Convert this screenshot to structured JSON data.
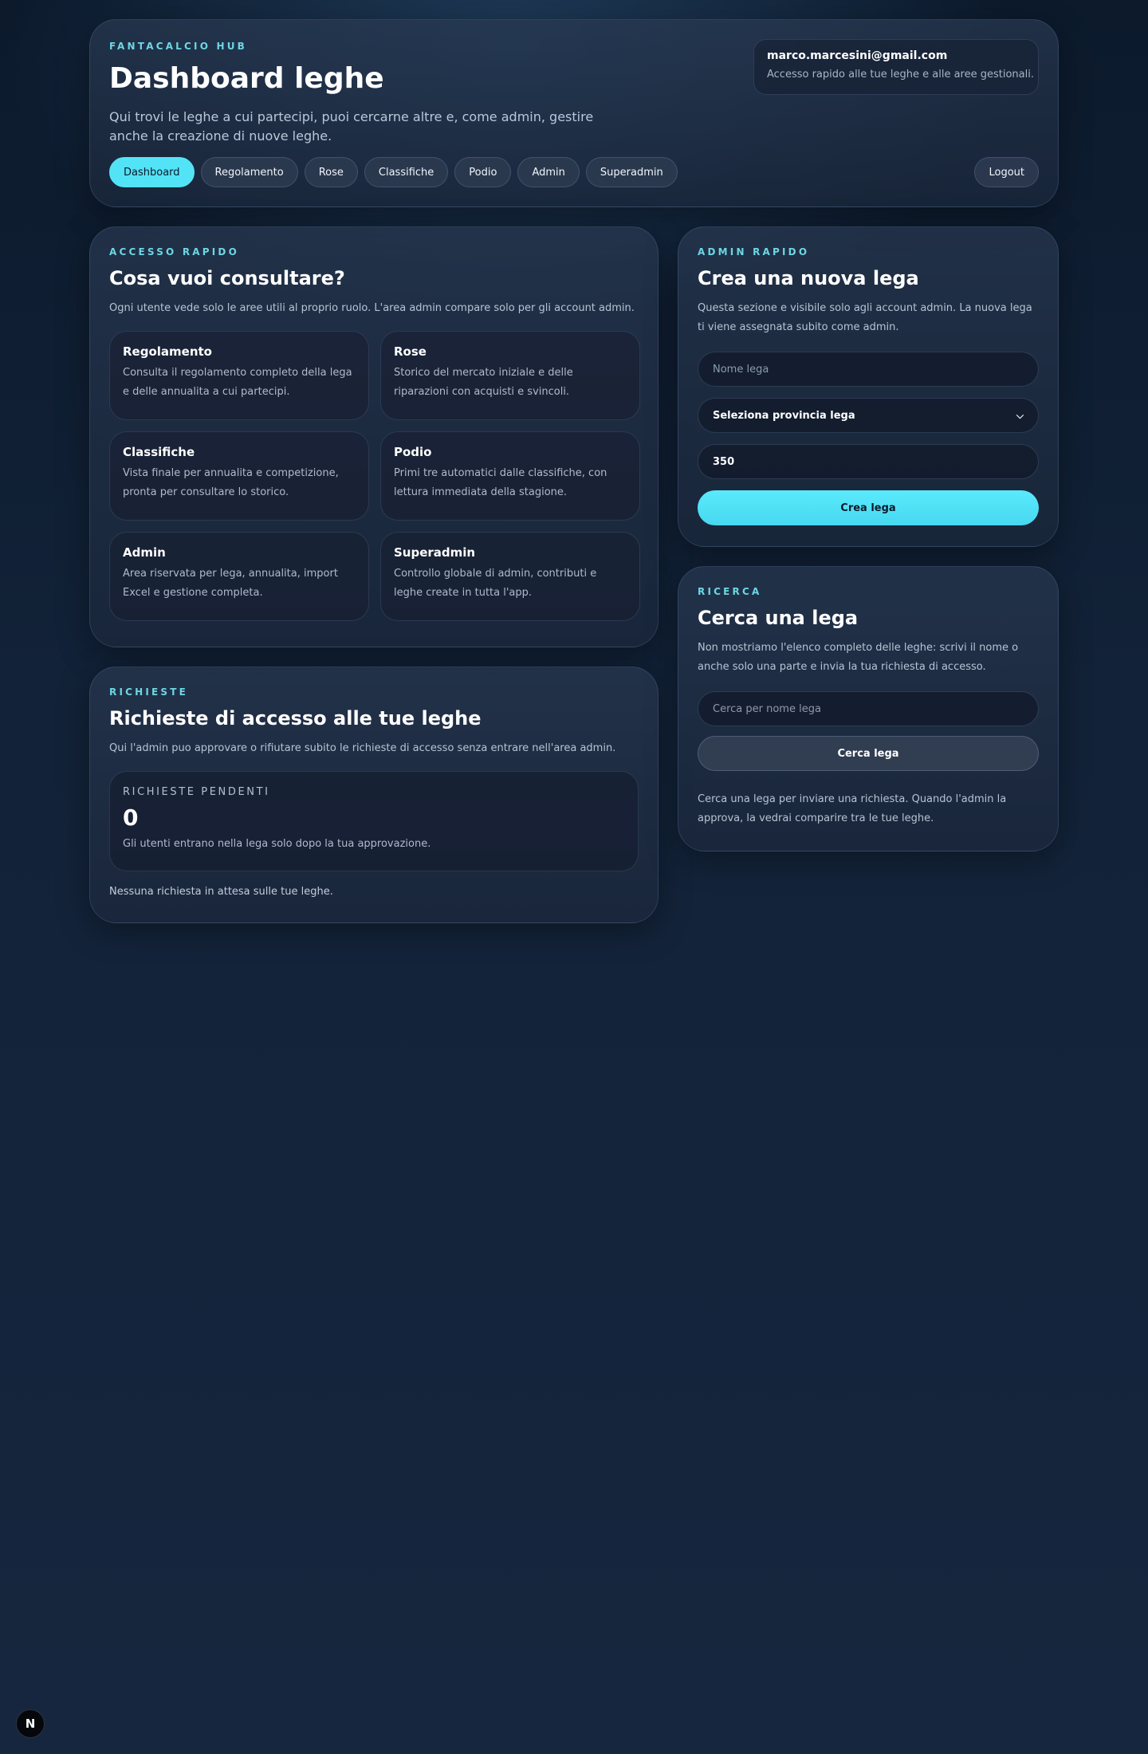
{
  "header": {
    "eyebrow": "FANTACALCIO HUB",
    "title": "Dashboard leghe",
    "description": "Qui trovi le leghe a cui partecipi, puoi cercarne altre e, come admin, gestire anche la creazione di nuove leghe.",
    "user_email": "marco.marcesini@gmail.com",
    "user_subtitle": "Accesso rapido alle tue leghe e alle aree gestionali.",
    "nav": [
      "Dashboard",
      "Regolamento",
      "Rose",
      "Classifiche",
      "Podio",
      "Admin",
      "Superadmin"
    ],
    "active_nav": "Dashboard",
    "logout": "Logout"
  },
  "quick_access": {
    "eyebrow": "ACCESSO RAPIDO",
    "title": "Cosa vuoi consultare?",
    "description": "Ogni utente vede solo le aree utili al proprio ruolo. L'area admin compare solo per gli account admin.",
    "tiles": [
      {
        "title": "Regolamento",
        "desc": "Consulta il regolamento completo della lega e delle annualita a cui partecipi."
      },
      {
        "title": "Rose",
        "desc": "Storico del mercato iniziale e delle riparazioni con acquisti e svincoli."
      },
      {
        "title": "Classifiche",
        "desc": "Vista finale per annualita e competizione, pronta per consultare lo storico."
      },
      {
        "title": "Podio",
        "desc": "Primi tre automatici dalle classifiche, con lettura immediata della stagione."
      },
      {
        "title": "Admin",
        "desc": "Area riservata per lega, annualita, import Excel e gestione completa."
      },
      {
        "title": "Superadmin",
        "desc": "Controllo globale di admin, contributi e leghe create in tutta l'app."
      }
    ]
  },
  "requests": {
    "eyebrow": "RICHIESTE",
    "title": "Richieste di accesso alle tue leghe",
    "description": "Qui l'admin puo approvare o rifiutare subito le richieste di accesso senza entrare nell'area admin.",
    "stat_label": "RICHIESTE PENDENTI",
    "stat_value": "0",
    "stat_desc": "Gli utenti entrano nella lega solo dopo la tua approvazione.",
    "empty_note": "Nessuna richiesta in attesa sulle tue leghe."
  },
  "create_league": {
    "eyebrow": "ADMIN RAPIDO",
    "title": "Crea una nuova lega",
    "description": "Questa sezione e visibile solo agli account admin. La nuova lega ti viene assegnata subito come admin.",
    "name_placeholder": "Nome lega",
    "province_select": "Seleziona provincia lega",
    "budget_value": "350",
    "submit": "Crea lega"
  },
  "search": {
    "eyebrow": "RICERCA",
    "title": "Cerca una lega",
    "description": "Non mostriamo l'elenco completo delle leghe: scrivi il nome o anche solo una parte e invia la tua richiesta di accesso.",
    "placeholder": "Cerca per nome lega",
    "button": "Cerca lega",
    "help": "Cerca una lega per inviare una richiesta. Quando l'admin la approva, la vedrai comparire tra le tue leghe."
  },
  "dev_badge": "N",
  "colors": {
    "accent": "#53e3f6",
    "eyebrow": "#6dd6e3",
    "background": "#122238"
  }
}
